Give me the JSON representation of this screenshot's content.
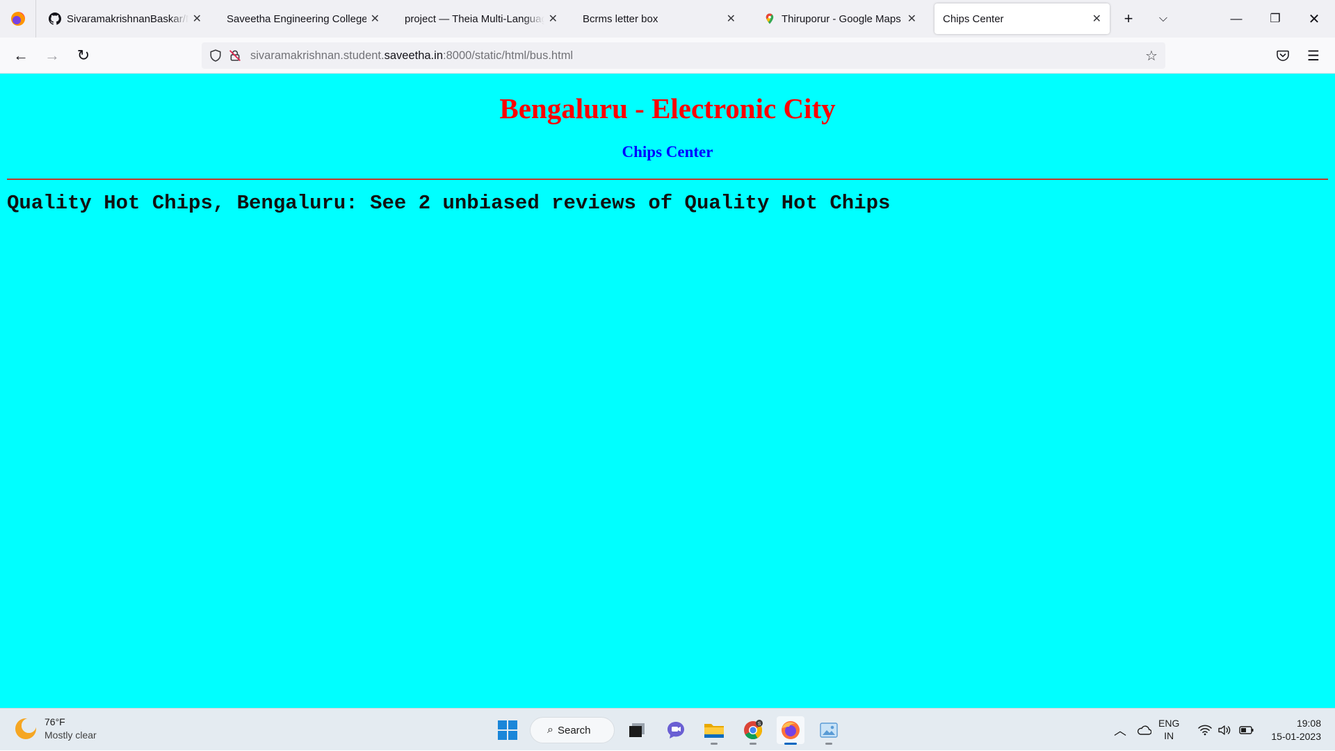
{
  "browser": {
    "tabs": [
      {
        "title": "SivaramakrishnanBaskar/Ne",
        "icon": "github-icon"
      },
      {
        "title": "Saveetha Engineering College",
        "icon": ""
      },
      {
        "title": "project — Theia Multi-Language",
        "icon": ""
      },
      {
        "title": "Bcrms letter box",
        "icon": ""
      },
      {
        "title": "Thiruporur - Google Maps",
        "icon": "google-maps-icon"
      },
      {
        "title": "Chips Center",
        "icon": "",
        "active": true
      }
    ],
    "url": {
      "prefix": "sivaramakrishnan.student.",
      "domain": "saveetha.in",
      "suffix": ":8000/static/html/bus.html"
    }
  },
  "page": {
    "background": "#00ffff",
    "heading": "Bengaluru - Electronic City",
    "heading_color": "#ff0000",
    "subheading": "Chips Center",
    "subheading_color": "#0000ff",
    "body_text": "Quality Hot Chips, Bengaluru: See 2 unbiased reviews of Quality Hot Chips"
  },
  "taskbar": {
    "weather": {
      "temp": "76°F",
      "desc": "Mostly clear"
    },
    "search_label": "Search",
    "language": {
      "line1": "ENG",
      "line2": "IN"
    },
    "clock": {
      "time": "19:08",
      "date": "15-01-2023"
    },
    "apps": [
      "start-icon",
      "search",
      "task-view-icon",
      "teams-chat-icon",
      "file-explorer-icon",
      "chrome-icon",
      "firefox-icon",
      "photos-icon"
    ]
  }
}
